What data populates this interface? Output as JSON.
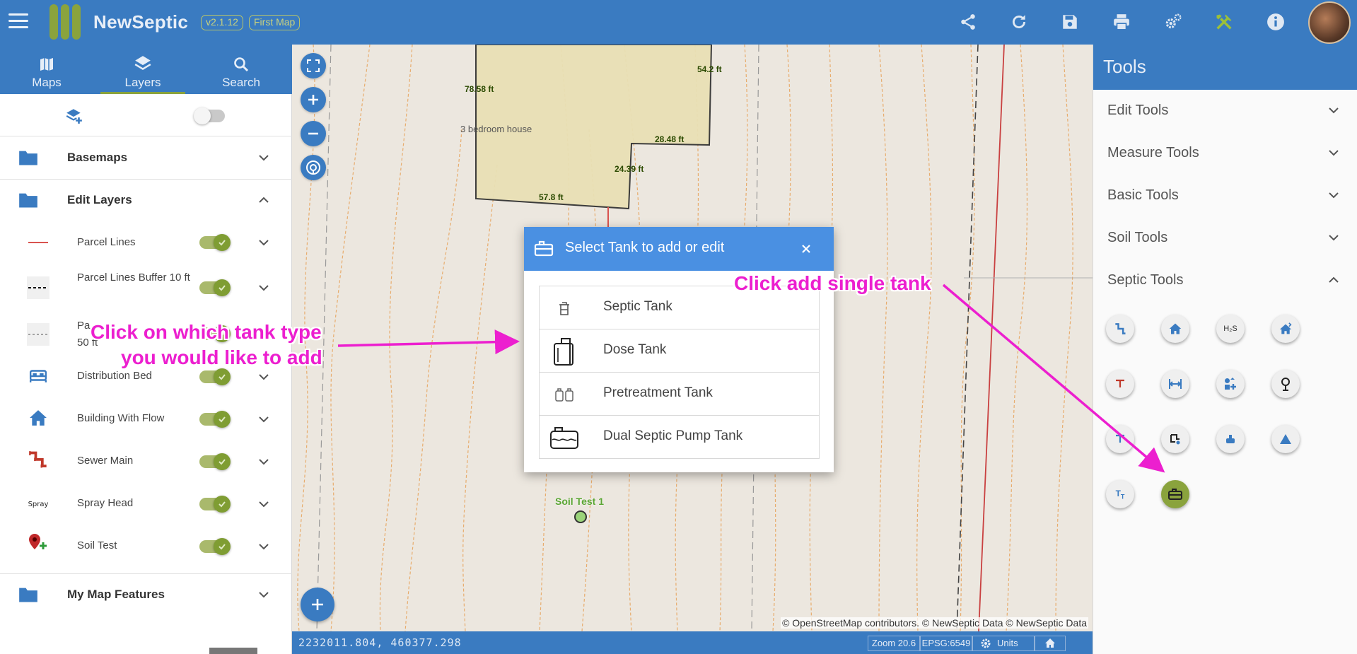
{
  "header": {
    "app_name": "NewSeptic",
    "version": "v2.1.12",
    "map_name": "First Map",
    "icons": [
      "menu-icon",
      "share-icon",
      "refresh-icon",
      "save-icon",
      "print-icon",
      "settings-icon",
      "tools-icon",
      "info-icon"
    ]
  },
  "left_tabs": [
    {
      "label": "Maps",
      "icon": "map-icon"
    },
    {
      "label": "Layers",
      "icon": "layers-icon"
    },
    {
      "label": "Search",
      "icon": "search-icon"
    }
  ],
  "layers": {
    "groups": {
      "basemaps": "Basemaps",
      "edit_layers": "Edit Layers",
      "my_map_features": "My Map Features"
    },
    "items": [
      {
        "label": "Parcel Lines",
        "visible": true
      },
      {
        "label": "Parcel Lines Buffer 10 ft",
        "visible": true
      },
      {
        "label": "50 ft",
        "prefix": "Pa",
        "visible": true
      },
      {
        "label": "Distribution Bed",
        "visible": true
      },
      {
        "label": "Building With Flow",
        "visible": true
      },
      {
        "label": "Sewer Main",
        "visible": true
      },
      {
        "label": "Spray Head",
        "visible": true
      },
      {
        "label": "Soil Test",
        "visible": true
      }
    ],
    "spray_icon_text": "Spray"
  },
  "map": {
    "labels": {
      "building": "3 bedroom house",
      "dim_1": "78.58 ft",
      "dim_2": "54.2 ft",
      "dim_3": "28.48 ft",
      "dim_4": "24.39 ft",
      "dim_5": "57.8 ft",
      "soil_test": "Soil Test 1"
    },
    "attribution": "© OpenStreetMap contributors. © NewSeptic Data © NewSeptic Data",
    "coordinates": "2232011.804, 460377.298",
    "zoom": "Zoom 20.6",
    "epsg": "EPSG:6549",
    "units": "Units"
  },
  "dialog": {
    "title": "Select Tank to add or edit",
    "items": [
      {
        "label": "Septic Tank",
        "icon": "septic-tank-icon"
      },
      {
        "label": "Dose Tank",
        "icon": "dose-tank-icon"
      },
      {
        "label": "Pretreatment Tank",
        "icon": "pretreatment-tank-icon"
      },
      {
        "label": "Dual Septic Pump Tank",
        "icon": "dual-septic-pump-tank-icon"
      }
    ]
  },
  "annotations": {
    "left_line1": "Click on which tank type",
    "left_line2": "you would like to add",
    "right": "Click add single tank",
    "color": "#ec1fcf"
  },
  "tools": {
    "title": "Tools",
    "sections": [
      "Edit Tools",
      "Measure Tools",
      "Basic Tools",
      "Soil Tools",
      "Septic Tools"
    ],
    "septic_buttons": [
      "sewer-pipe-icon",
      "building-icon",
      "h2s-icon",
      "flow-icon",
      "tee-icon",
      "distance-icon",
      "shapes-add-icon",
      "pump-icon",
      "tee-alt-icon",
      "pump-vault-icon",
      "tank-riser-icon",
      "triangle-icon",
      "text-size-icon",
      "single-tank-icon"
    ]
  },
  "colors": {
    "primary": "#3a7bc1",
    "accent": "#8aa33d",
    "dialog_header": "#4a90e2"
  }
}
